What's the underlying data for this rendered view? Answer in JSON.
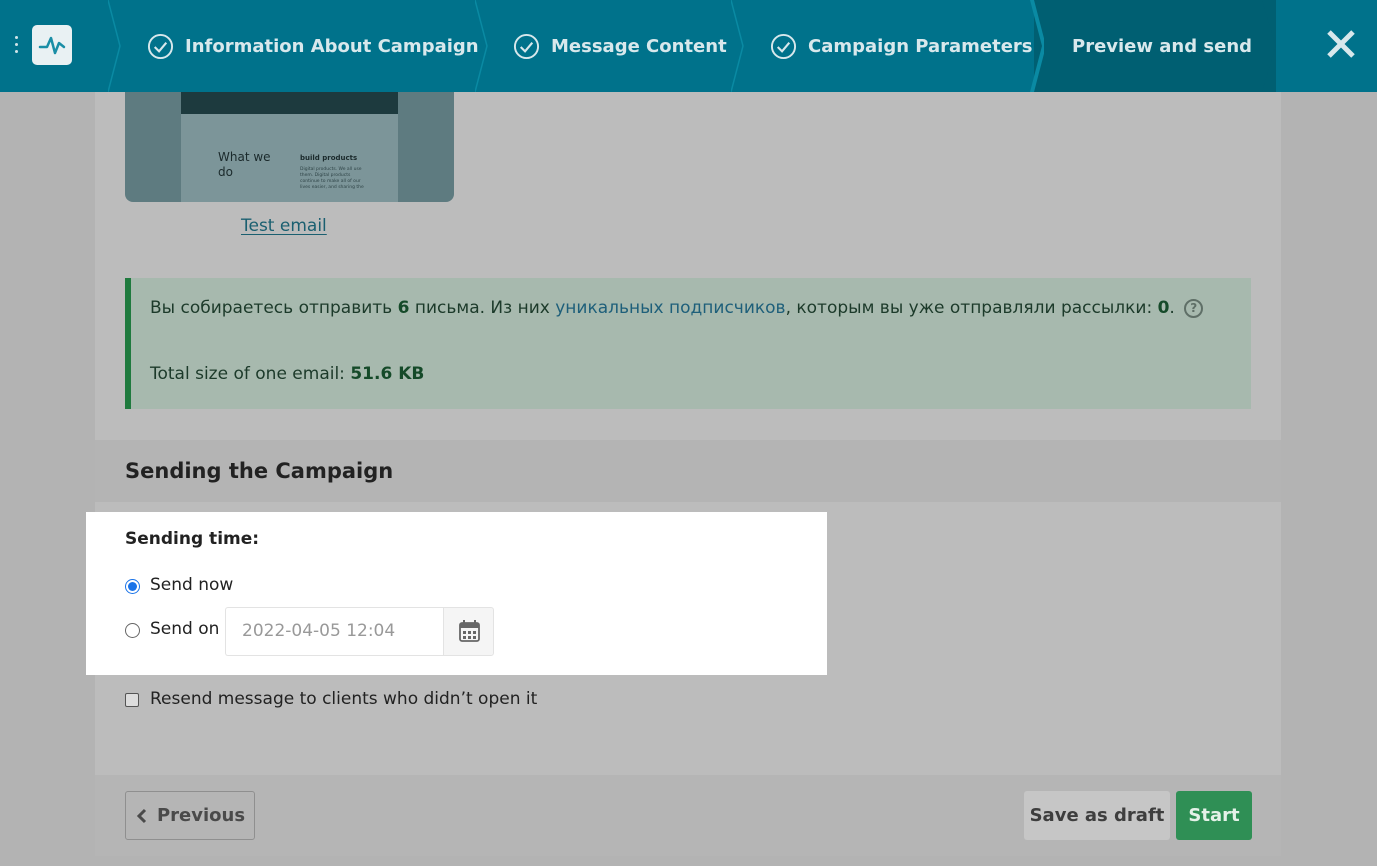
{
  "wizard": {
    "steps": [
      {
        "label": "Information About Campaign",
        "done": true
      },
      {
        "label": "Message Content",
        "done": true
      },
      {
        "label": "Campaign Parameters",
        "done": true
      },
      {
        "label": "Preview and send",
        "done": false,
        "active": true
      }
    ],
    "close_icon": "close-icon",
    "logo_icon": "pulse-logo-icon"
  },
  "preview": {
    "heading": "What we do",
    "subheading": "build products",
    "body_snippet": "Digital products. We all use them. Digital products continue to make all of our lives easier, and sharing the",
    "test_link": "Test email"
  },
  "summary": {
    "line1_pre": "Вы собираетесь отправить ",
    "letters_count": "6",
    "line1_mid": " письма.  Из них ",
    "unique_link": "уникальных подписчиков",
    "line1_post": ", которым вы уже отправляли рассылки: ",
    "already_sent": "0",
    "line1_end": ".",
    "help_icon": "?",
    "size_label": "Total size of one email: ",
    "size_value": "51.6 KB"
  },
  "sending": {
    "section_title": "Sending the Campaign",
    "time_label": "Sending time:",
    "options": [
      {
        "label": "Send now",
        "selected": true
      },
      {
        "label": "Send on",
        "selected": false
      }
    ],
    "date_placeholder": "2022-04-05 12:04",
    "resend_label": "Resend message to clients who didn’t open it",
    "resend_checked": false
  },
  "footer": {
    "previous_label": "Previous",
    "draft_label": "Save as draft",
    "start_label": "Start"
  },
  "colors": {
    "topbar": "#00728b",
    "active_step": "#005f72",
    "success_border": "#1f7a3e",
    "start_button": "#2f8f55",
    "radio_accent": "#1a73e8"
  }
}
